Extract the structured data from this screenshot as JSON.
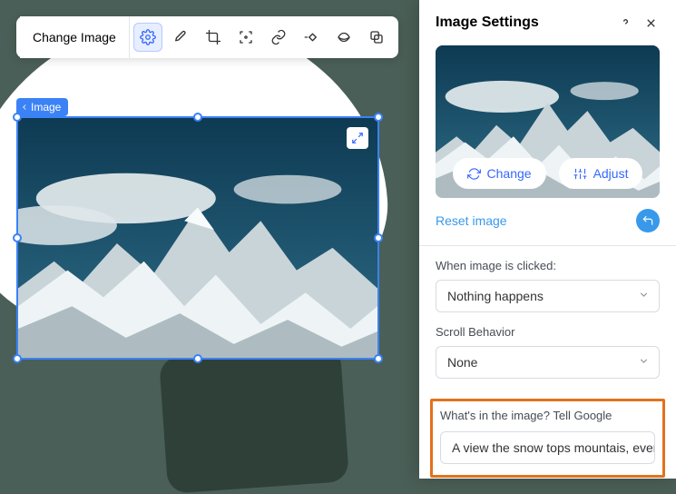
{
  "toolbar": {
    "change_label": "Change Image",
    "icons": {
      "settings": "settings-icon",
      "brush": "brush-icon",
      "crop": "crop-icon",
      "focal": "focal-icon",
      "link": "link-icon",
      "anim": "animation-icon",
      "mask": "mask-icon",
      "overlap": "overlap-icon"
    }
  },
  "breadcrumb": {
    "label": "Image"
  },
  "canvas": {
    "expand_tooltip": "Expand"
  },
  "panel": {
    "title": "Image Settings",
    "preview": {
      "change_label": "Change",
      "adjust_label": "Adjust"
    },
    "reset_label": "Reset image",
    "click_section": {
      "label": "When image is clicked:",
      "value": "Nothing happens"
    },
    "scroll_section": {
      "label": "Scroll Behavior",
      "value": "None"
    },
    "alt_section": {
      "label": "What's in the image? Tell Google",
      "value": "A view the snow tops mountais, ever…"
    }
  }
}
